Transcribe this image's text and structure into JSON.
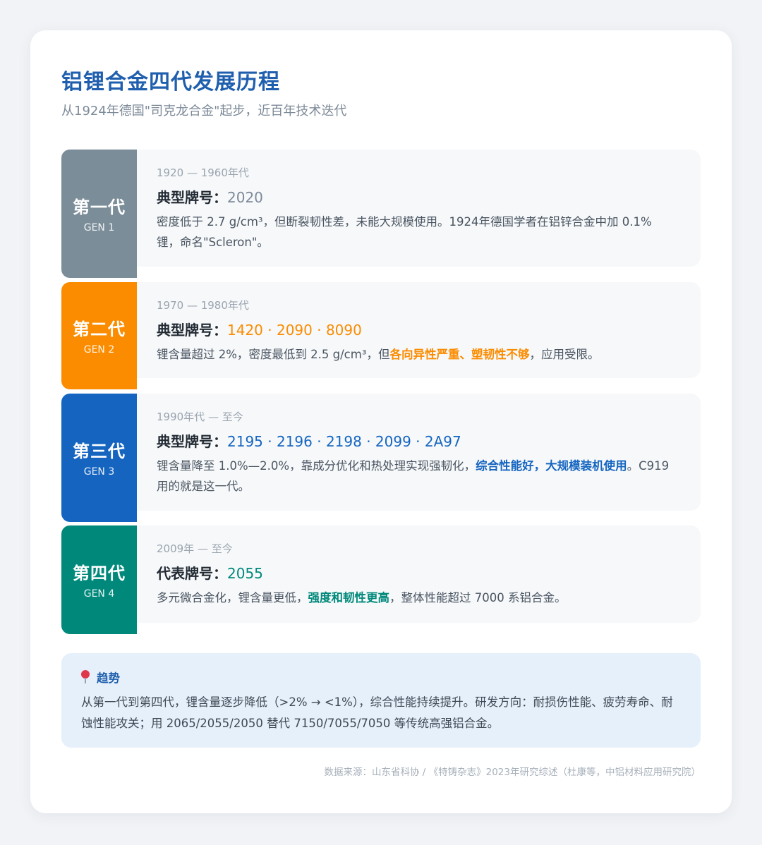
{
  "header": {
    "title": "铝锂合金四代发展历程",
    "subtitle": "从1924年德国\"司克龙合金\"起步，近百年技术迭代"
  },
  "generations": [
    {
      "name": "第一代",
      "code": "GEN 1",
      "color": "#7b8d99",
      "period": "1920 — 1960年代",
      "models_label": "典型牌号：",
      "models": "2020",
      "models_color": "#7d8a98",
      "desc_pre": "密度低于 2.7 g/cm³，但断裂韧性差，未能大规模使用。1924年德国学者在铝锌合金中加 0.1% 锂，命名\"Scleron\"。",
      "desc_highlight": "",
      "desc_post": ""
    },
    {
      "name": "第二代",
      "code": "GEN 2",
      "color": "#fb8c00",
      "period": "1970 — 1980年代",
      "models_label": "典型牌号：",
      "models": "1420 · 2090 · 8090",
      "models_color": "#fb8c00",
      "desc_pre": "锂含量超过 2%，密度最低到 2.5 g/cm³，但",
      "desc_highlight": "各向异性严重、塑韧性不够",
      "desc_post": "，应用受限。"
    },
    {
      "name": "第三代",
      "code": "GEN 3",
      "color": "#1565c0",
      "period": "1990年代 — 至今",
      "models_label": "典型牌号：",
      "models": "2195 · 2196 · 2198 · 2099 · 2A97",
      "models_color": "#1565c0",
      "desc_pre": "锂含量降至 1.0%—2.0%，靠成分优化和热处理实现强韧化，",
      "desc_highlight": "综合性能好，大规模装机使用",
      "desc_post": "。C919 用的就是这一代。"
    },
    {
      "name": "第四代",
      "code": "GEN 4",
      "color": "#00897b",
      "period": "2009年 — 至今",
      "models_label": "代表牌号：",
      "models": "2055",
      "models_color": "#00897b",
      "desc_pre": "多元微合金化，锂含量更低，",
      "desc_highlight": "强度和韧性更高",
      "desc_post": "，整体性能超过 7000 系铝合金。"
    }
  ],
  "trend": {
    "label": "趋势",
    "icon": "pin-icon",
    "text": "从第一代到第四代，锂含量逐步降低（>2% → <1%），综合性能持续提升。研发方向：耐损伤性能、疲劳寿命、耐蚀性能攻关；用 2065/2055/2050 替代 7150/7055/7050 等传统高强铝合金。"
  },
  "source": "数据来源：山东省科协 / 《特铸杂志》2023年研究综述（杜康等，中铝材料应用研究院）"
}
